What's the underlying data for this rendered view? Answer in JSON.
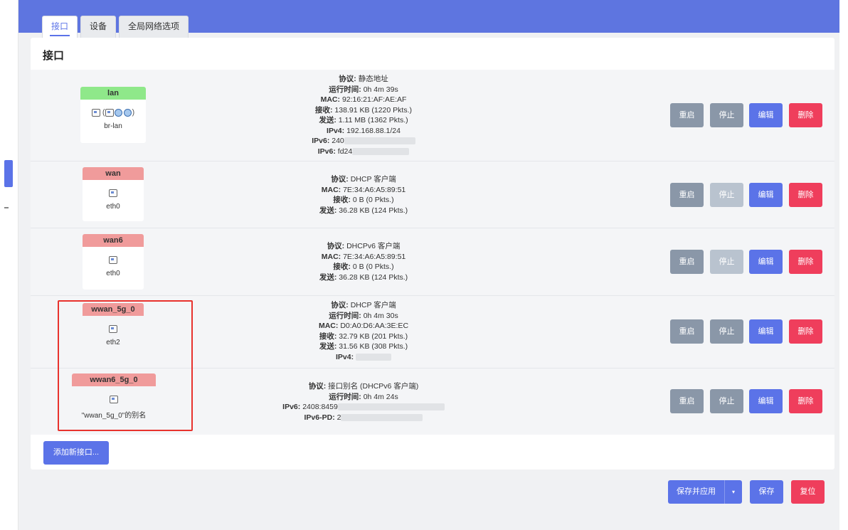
{
  "tabs": [
    {
      "label": "接口"
    },
    {
      "label": "设备"
    },
    {
      "label": "全局网络选项"
    }
  ],
  "panel_title": "接口",
  "buttons": {
    "restart": "重启",
    "stop": "停止",
    "edit": "编辑",
    "delete": "删除",
    "add_interface": "添加新接口...",
    "save_apply": "保存并应用",
    "save": "保存",
    "reset": "复位",
    "dropdown_caret": "▾"
  },
  "interfaces": [
    {
      "name": "lan",
      "device": "br-lan",
      "color": "#8fe88a",
      "info": [
        {
          "k": "协议:",
          "v": "静态地址"
        },
        {
          "k": "运行时间:",
          "v": "0h 4m 39s"
        },
        {
          "k": "MAC:",
          "v": "92:16:21:AF:AE:AF"
        },
        {
          "k": "接收:",
          "v": "138.91 KB (1220 Pkts.)"
        },
        {
          "k": "发送:",
          "v": "1.11 MB (1362 Pkts.)"
        },
        {
          "k": "IPv4:",
          "v": "192.168.88.1/24"
        },
        {
          "k": "IPv6:",
          "v": "240"
        },
        {
          "k": "IPv6:",
          "v": "fd24"
        }
      ]
    },
    {
      "name": "wan",
      "device": "eth0",
      "color": "#f09b9b",
      "info": [
        {
          "k": "协议:",
          "v": "DHCP 客户端"
        },
        {
          "k": "MAC:",
          "v": "7E:34:A6:A5:89:51"
        },
        {
          "k": "接收:",
          "v": "0 B (0 Pkts.)"
        },
        {
          "k": "发送:",
          "v": "36.28 KB (124 Pkts.)"
        }
      ]
    },
    {
      "name": "wan6",
      "device": "eth0",
      "color": "#f09b9b",
      "info": [
        {
          "k": "协议:",
          "v": "DHCPv6 客户端"
        },
        {
          "k": "MAC:",
          "v": "7E:34:A6:A5:89:51"
        },
        {
          "k": "接收:",
          "v": "0 B (0 Pkts.)"
        },
        {
          "k": "发送:",
          "v": "36.28 KB (124 Pkts.)"
        }
      ]
    },
    {
      "name": "wwan_5g_0",
      "device": "eth2",
      "color": "#f09b9b",
      "info": [
        {
          "k": "协议:",
          "v": "DHCP 客户端"
        },
        {
          "k": "运行时间:",
          "v": "0h 4m 30s"
        },
        {
          "k": "MAC:",
          "v": "D0:A0:D6:AA:3E:EC"
        },
        {
          "k": "接收:",
          "v": "32.79 KB (201 Pkts.)"
        },
        {
          "k": "发送:",
          "v": "31.56 KB (308 Pkts.)"
        },
        {
          "k": "IPv4:",
          "v": ""
        }
      ]
    },
    {
      "name": "wwan6_5g_0",
      "device": "\"wwan_5g_0\"的别名",
      "color": "#f09b9b",
      "info": [
        {
          "k": "协议:",
          "v": "接口别名 (DHCPv6 客户端)"
        },
        {
          "k": "运行时间:",
          "v": "0h 4m 24s"
        },
        {
          "k": "IPv6:",
          "v": "2408:8459"
        },
        {
          "k": "IPv6-PD:",
          "v": "2"
        }
      ]
    }
  ],
  "icons": {
    "network_port": "network-port-icon",
    "wireless": "wireless-globe-icon"
  }
}
